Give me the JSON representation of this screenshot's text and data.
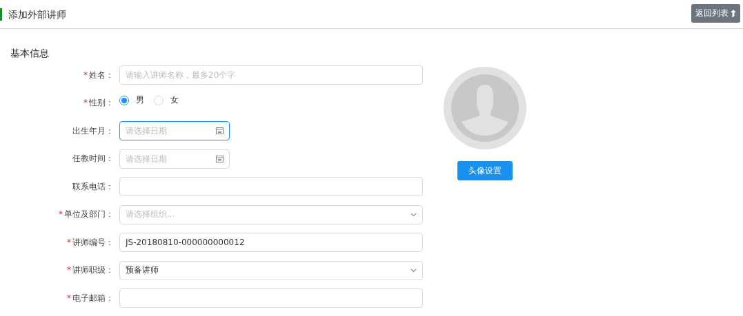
{
  "header": {
    "title": "添加外部讲师",
    "back_button": "返回列表"
  },
  "section": {
    "title": "基本信息"
  },
  "fields": [
    {
      "kind": "text",
      "label": "姓名：",
      "required_mark": "*",
      "placeholder": "请输入讲师名称，最多20个字"
    },
    {
      "kind": "radio",
      "label": "性别：",
      "required_mark": "*",
      "options": [
        {
          "label": "男",
          "selected": true
        },
        {
          "label": "女",
          "selected": false
        }
      ]
    },
    {
      "kind": "date",
      "label": "出生年月：",
      "placeholder": "请选择日期",
      "focused": true
    },
    {
      "kind": "date",
      "label": "任教时间：",
      "placeholder": "请选择日期",
      "focused": false
    },
    {
      "kind": "text",
      "label": "联系电话："
    },
    {
      "kind": "select",
      "label": "单位及部门：",
      "required_mark": "*",
      "placeholder": "请选择组织..."
    },
    {
      "kind": "text",
      "label": "讲师编号：",
      "required_mark": "*",
      "value": "JS-20180810-000000000012"
    },
    {
      "kind": "select",
      "label": "讲师职级：",
      "required_mark": "*",
      "value": "预备讲师"
    },
    {
      "kind": "text",
      "label": "电子邮箱：",
      "required_mark": "*"
    }
  ],
  "avatar": {
    "button": "头像设置"
  }
}
